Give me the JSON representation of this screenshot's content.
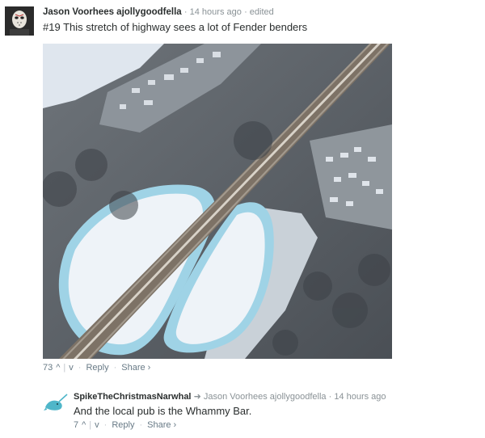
{
  "comment": {
    "author": "Jason Voorhees ajollygoodfella",
    "time": "14 hours ago",
    "edited": "edited",
    "text": "#19 This stretch of highway sees a lot of Fender benders",
    "votes": "73",
    "upvote_icon": "^",
    "downvote_icon": "v",
    "reply_label": "Reply",
    "share_label": "Share",
    "share_chevron": "›"
  },
  "reply": {
    "author": "SpikeTheChristmasNarwhal",
    "reply_arrow": "➜",
    "reply_to": "Jason Voorhees ajollygoodfella",
    "time": "14 hours ago",
    "text": "And the local pub is the Whammy Bar.",
    "votes": "7",
    "upvote_icon": "^",
    "downvote_icon": "v",
    "reply_label": "Reply",
    "share_label": "Share",
    "share_chevron": "›"
  },
  "colors": {
    "author": "#2a2e2e",
    "meta": "#8a9296",
    "snow": "#eef3f8",
    "ice": "#9fd3e6"
  }
}
